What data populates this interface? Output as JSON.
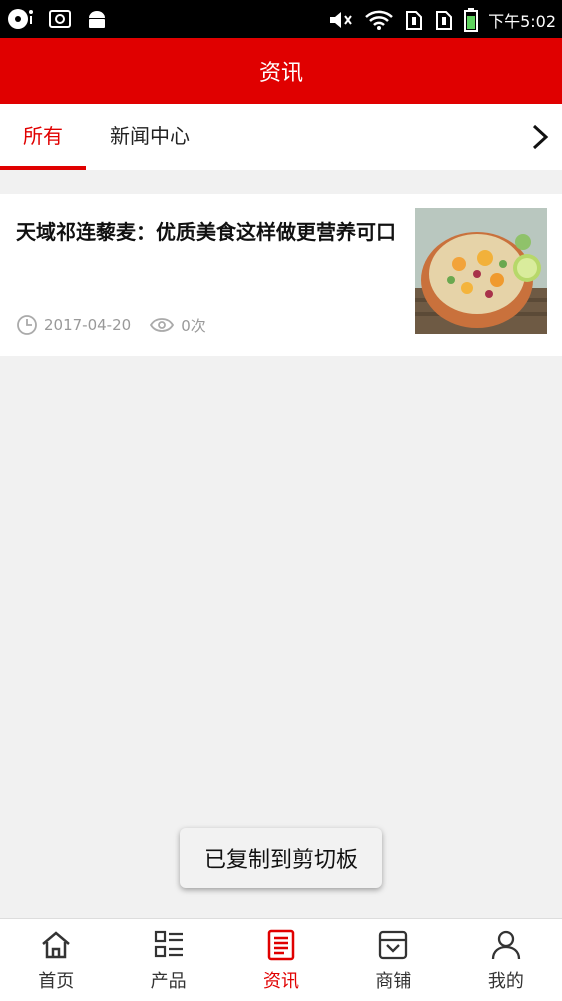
{
  "status": {
    "time": "下午5:02"
  },
  "header": {
    "title": "资讯"
  },
  "tabs": [
    {
      "label": "所有"
    },
    {
      "label": "新闻中心"
    }
  ],
  "articles": [
    {
      "title": "天域祁连藜麦：优质美食这样做更营养可口",
      "date": "2017-04-20",
      "views": "0次"
    }
  ],
  "toast": {
    "text": "已复制到剪切板"
  },
  "nav": [
    {
      "label": "首页"
    },
    {
      "label": "产品"
    },
    {
      "label": "资讯"
    },
    {
      "label": "商铺"
    },
    {
      "label": "我的"
    }
  ],
  "colors": {
    "brand": "#e00000"
  }
}
